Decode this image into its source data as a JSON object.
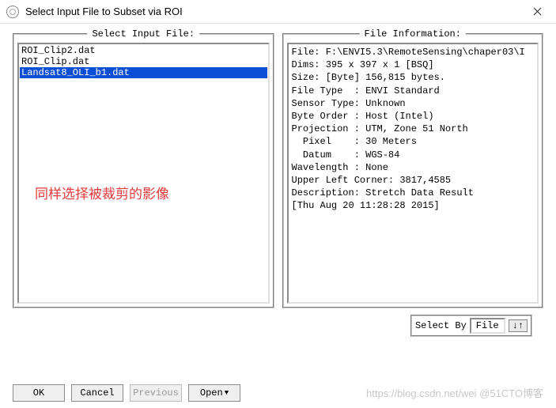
{
  "title": "Select Input File to Subset via ROI",
  "panels": {
    "left_label": "Select Input File:",
    "right_label": "File Information:"
  },
  "files": [
    "ROI_Clip2.dat",
    "ROI_Clip.dat",
    "Landsat8_OLI_b1.dat"
  ],
  "selected_index": 2,
  "annotation": "同样选择被裁剪的影像",
  "file_info": "File: F:\\ENVI5.3\\RemoteSensing\\chaper03\\I\nDims: 395 x 397 x 1 [BSQ]\nSize: [Byte] 156,815 bytes.\nFile Type  : ENVI Standard\nSensor Type: Unknown\nByte Order : Host (Intel)\nProjection : UTM, Zone 51 North\n  Pixel    : 30 Meters\n  Datum    : WGS-84\nWavelength : None\nUpper Left Corner: 3817,4585\nDescription: Stretch Data Result\n[Thu Aug 20 11:28:28 2015]",
  "select_by": {
    "label": "Select By",
    "value": "File"
  },
  "buttons": {
    "ok": "OK",
    "cancel": "Cancel",
    "previous": "Previous",
    "open": "Open"
  },
  "watermark": "https://blog.csdn.net/wei  @51CTO博客"
}
